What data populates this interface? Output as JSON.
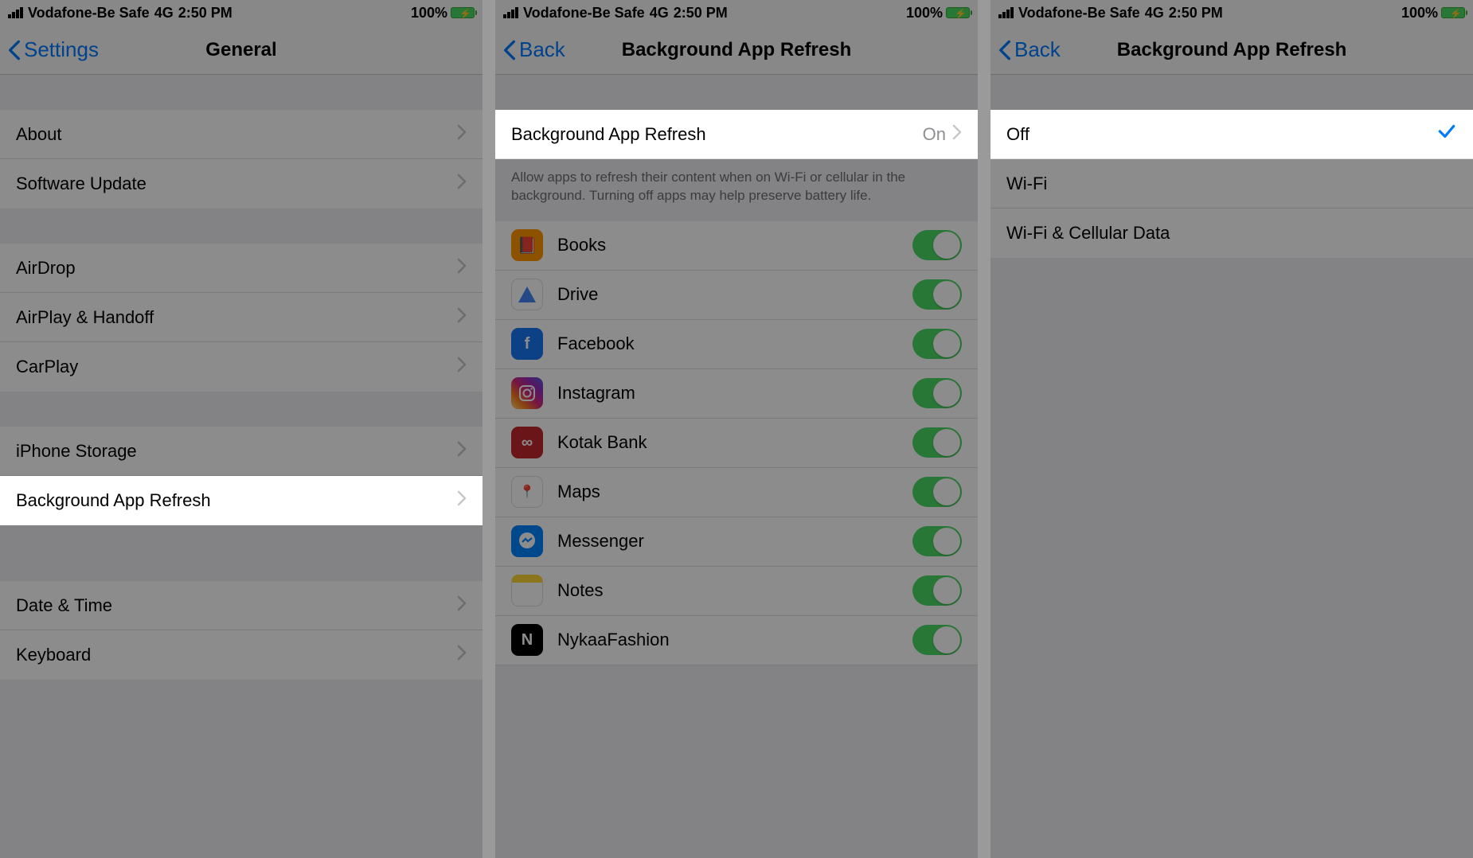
{
  "status": {
    "carrier": "Vodafone-Be Safe",
    "network": "4G",
    "time": "2:50 PM",
    "battery_pct": "100%"
  },
  "screen1": {
    "nav_back": "Settings",
    "nav_title": "General",
    "group1": [
      "About",
      "Software Update"
    ],
    "group2": [
      "AirDrop",
      "AirPlay & Handoff",
      "CarPlay"
    ],
    "group3": [
      "iPhone Storage",
      "Background App Refresh"
    ],
    "group4": [
      "Date & Time",
      "Keyboard"
    ],
    "highlighted": "Background App Refresh"
  },
  "screen2": {
    "nav_back": "Back",
    "nav_title": "Background App Refresh",
    "master_row": {
      "label": "Background App Refresh",
      "value": "On"
    },
    "footer": "Allow apps to refresh their content when on Wi-Fi or cellular in the background. Turning off apps may help preserve battery life.",
    "apps": [
      {
        "name": "Books",
        "icon": "ic-books",
        "glyph": "📕",
        "toggle": true
      },
      {
        "name": "Drive",
        "icon": "ic-drive",
        "glyph": "",
        "toggle": true
      },
      {
        "name": "Facebook",
        "icon": "ic-facebook",
        "glyph": "f",
        "toggle": true
      },
      {
        "name": "Instagram",
        "icon": "ic-instagram",
        "glyph": "",
        "toggle": true
      },
      {
        "name": "Kotak Bank",
        "icon": "ic-kotak",
        "glyph": "∞",
        "toggle": true
      },
      {
        "name": "Maps",
        "icon": "ic-maps",
        "glyph": "",
        "toggle": true
      },
      {
        "name": "Messenger",
        "icon": "ic-messenger",
        "glyph": "",
        "toggle": true
      },
      {
        "name": "Notes",
        "icon": "ic-notes",
        "glyph": "",
        "toggle": true
      },
      {
        "name": "NykaaFashion",
        "icon": "ic-nykaa",
        "glyph": "N",
        "toggle": true
      }
    ]
  },
  "screen3": {
    "nav_back": "Back",
    "nav_title": "Background App Refresh",
    "options": [
      {
        "label": "Off",
        "selected": true
      },
      {
        "label": "Wi-Fi",
        "selected": false
      },
      {
        "label": "Wi-Fi & Cellular Data",
        "selected": false
      }
    ],
    "highlighted": "Off"
  }
}
